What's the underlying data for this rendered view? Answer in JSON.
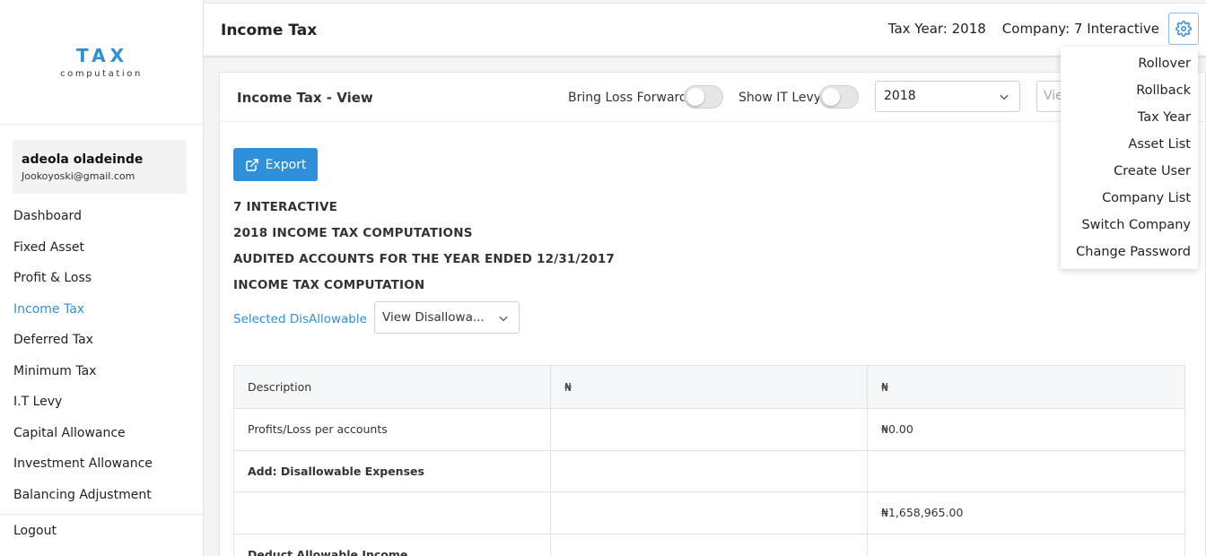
{
  "logo": {
    "main": "TAX",
    "sub": "computation"
  },
  "user": {
    "name": "adeola oladeinde",
    "email": "Jookoyoski@gmail.com"
  },
  "nav": [
    {
      "label": "Dashboard",
      "active": false
    },
    {
      "label": "Fixed Asset",
      "active": false
    },
    {
      "label": "Profit & Loss",
      "active": false
    },
    {
      "label": "Income Tax",
      "active": true
    },
    {
      "label": "Deferred Tax",
      "active": false
    },
    {
      "label": "Minimum Tax",
      "active": false
    },
    {
      "label": "I.T Levy",
      "active": false
    },
    {
      "label": "Capital Allowance",
      "active": false
    },
    {
      "label": "Investment Allowance",
      "active": false
    },
    {
      "label": "Balancing Adjustment",
      "active": false
    }
  ],
  "logout_label": "Logout",
  "header": {
    "title": "Income Tax",
    "tax_year": "Tax Year: 2018",
    "company": "Company: 7 Interactive",
    "settings_icon": "gear-icon"
  },
  "settings_menu": [
    "Rollover",
    "Rollback",
    "Tax Year",
    "Asset List",
    "Create User",
    "Company List",
    "Switch Company",
    "Change Password"
  ],
  "card": {
    "title": "Income Tax - View",
    "bring_loss_label": "Bring Loss Forward",
    "bring_loss_on": false,
    "show_levy_label": "Show IT Levy",
    "show_levy_on": false,
    "year_value": "2018",
    "view_placeholder": "Vie"
  },
  "export_label": "Export",
  "headings": [
    "7 INTERACTIVE",
    "2018 INCOME TAX COMPUTATIONS",
    "AUDITED ACCOUNTS FOR THE YEAR ENDED 12/31/2017",
    "INCOME TAX COMPUTATION"
  ],
  "selected_label": "Selected DisAllowable",
  "disallow_select_value": "View Disallowa...",
  "table": {
    "headers": [
      "Description",
      "₦",
      "₦"
    ],
    "rows": [
      {
        "cells": [
          "Profits/Loss per accounts",
          "",
          "₦0.00"
        ],
        "bold": false
      },
      {
        "cells": [
          "Add: Disallowable Expenses",
          "",
          ""
        ],
        "bold": true
      },
      {
        "cells": [
          "",
          "",
          "₦1,658,965.00"
        ],
        "bold": false
      },
      {
        "cells": [
          "Deduct Allowable Income",
          "",
          ""
        ],
        "bold": true
      }
    ]
  },
  "colors": {
    "accent": "#2f8fd8"
  }
}
